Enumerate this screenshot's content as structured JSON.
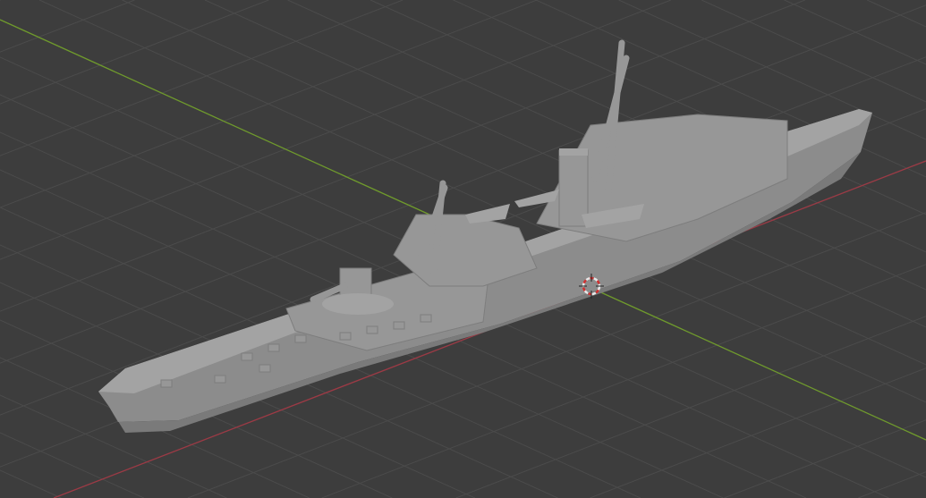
{
  "viewport": {
    "object": "ship-model",
    "cursor_icon": "3d-cursor-icon"
  },
  "colors": {
    "background": "#3d3d3d",
    "grid": "#4b4b4b",
    "x_axis": "#9c3a45",
    "y_axis": "#6f9a2c",
    "hull": "#8c8c8c",
    "hull_dark": "#7a7a7a",
    "deck": "#a3a3a3",
    "super": "#979797"
  }
}
